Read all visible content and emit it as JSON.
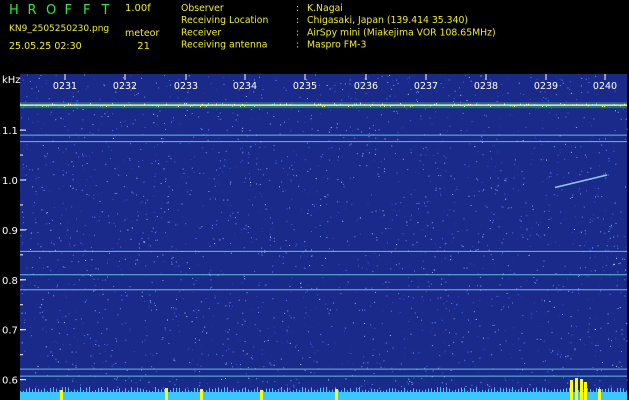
{
  "header": {
    "logo_letters": [
      "H",
      "R",
      "O",
      "F",
      "F",
      "T"
    ],
    "version": "1.00f",
    "filename": "KN9_2505250230.png",
    "datetime": "25.05.25 02:30",
    "meteor_label": "meteor",
    "meteor_count": "21",
    "info": [
      {
        "key": "Observer",
        "sep": ":",
        "value": "K.Nagai"
      },
      {
        "key": "Receiving Location",
        "sep": ":",
        "value": "Chigasaki, Japan (139.414 35.340)"
      },
      {
        "key": "Receiver",
        "sep": ":",
        "value": "AirSpy mini (Miakejima VOR 108.65MHz)"
      },
      {
        "key": "Receiving antenna",
        "sep": ":",
        "value": "Maspro FM-3"
      }
    ]
  },
  "chart_data": {
    "type": "heatmap",
    "ylabel": "kHz",
    "time_ticks": [
      "0231",
      "0232",
      "0233",
      "0234",
      "0235",
      "0236",
      "0237",
      "0238",
      "0239",
      "0240"
    ],
    "y_ticks": [
      1.1,
      1.0,
      0.9,
      0.8,
      0.7,
      0.6
    ],
    "ylim": [
      0.58,
      1.2
    ],
    "grid": false,
    "colors": {
      "background": "#1a2a8a",
      "noise_bright": "#5a7cff",
      "lines": "#6ed8e8",
      "carrier": "#e8ff5a",
      "bottom_bar": "#37c8ff",
      "spikes": "#ffff00"
    },
    "horizontal_lines_khz": [
      1.15,
      1.09,
      1.077,
      0.857,
      0.81,
      0.78,
      0.621,
      0.607
    ],
    "carrier_khz": 1.15,
    "meteor_echo": {
      "from": {
        "time": "0239.3",
        "khz": 0.985
      },
      "to": {
        "time": "0240",
        "khz": 1.01
      }
    }
  }
}
